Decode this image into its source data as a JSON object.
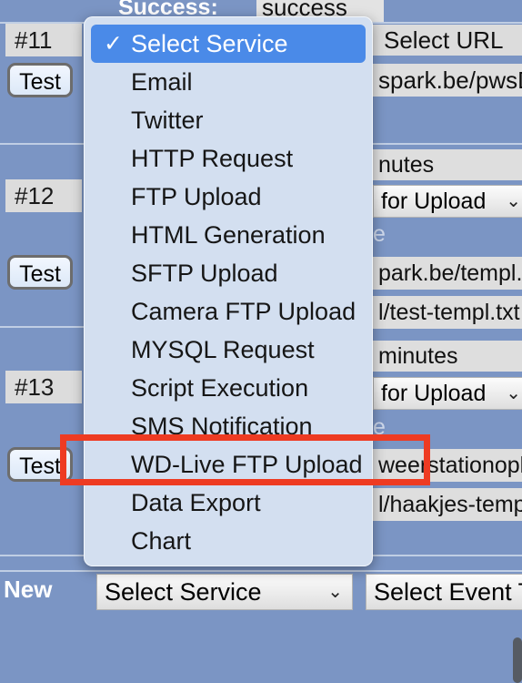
{
  "window": {
    "background_color": "#7b95c4",
    "accent_blue": "#4a8ae8",
    "annotation_color": "#ee3b22"
  },
  "top_bar": {
    "success_label": "Success:",
    "success_value": "success"
  },
  "rows": [
    {
      "id": "#11",
      "test_button": "Test",
      "service_select": "Select Service",
      "url_select": "Select URL",
      "url_value": "spark.be/pwsDW"
    },
    {
      "id": "#12",
      "test_button": "Test",
      "interval_text": "nutes",
      "upload_select": "for Upload",
      "template_label": "e",
      "template_value": "park.be/templ.tx",
      "target_value": "l/test-templ.txt"
    },
    {
      "id": "#13",
      "test_button": "Test",
      "interval_text": "minutes",
      "upload_select": "for Upload",
      "template_label": "e",
      "template_value": "weerstationopl",
      "target_value": "l/haakjes-temp"
    }
  ],
  "new_row": {
    "label": "New",
    "service_select": "Select Service",
    "event_select": "Select Event T"
  },
  "service_menu": {
    "name": "select-service-dropdown",
    "selected_index": 0,
    "items": [
      {
        "label": "Select Service",
        "selected": true,
        "check": "✓"
      },
      {
        "label": "Email",
        "selected": false
      },
      {
        "label": "Twitter",
        "selected": false
      },
      {
        "label": "HTTP Request",
        "selected": false
      },
      {
        "label": "FTP Upload",
        "selected": false
      },
      {
        "label": "HTML Generation",
        "selected": false
      },
      {
        "label": "SFTP Upload",
        "selected": false
      },
      {
        "label": "Camera FTP Upload",
        "selected": false
      },
      {
        "label": "MYSQL Request",
        "selected": false
      },
      {
        "label": "Script Execution",
        "selected": false
      },
      {
        "label": "SMS Notification",
        "selected": false
      },
      {
        "label": "WD-Live FTP Upload",
        "selected": false,
        "highlighted": true
      },
      {
        "label": "Data Export",
        "selected": false
      },
      {
        "label": "Chart",
        "selected": false
      }
    ]
  },
  "icons": {
    "chevron_down": "⌄",
    "checkmark": "✓"
  }
}
